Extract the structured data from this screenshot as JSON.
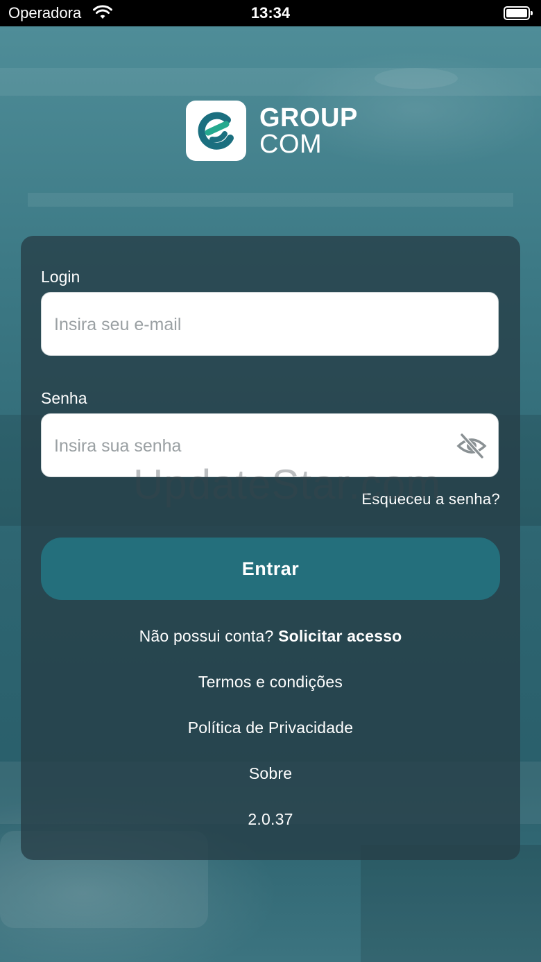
{
  "status_bar": {
    "carrier": "Operadora",
    "time": "13:34"
  },
  "brand": {
    "line1": "GROUP",
    "line2": "COM",
    "logo_color": "#1b6f7f",
    "logo_accent": "#25a98f"
  },
  "login_form": {
    "login_label": "Login",
    "email_placeholder": "Insira seu e-mail",
    "password_label": "Senha",
    "password_placeholder": "Insira sua senha",
    "forgot_password": "Esqueceu a senha?",
    "submit_label": "Entrar"
  },
  "links": {
    "no_account": "Não possui conta?",
    "request_access": "Solicitar acesso",
    "terms": "Termos e condições",
    "privacy": "Política de Privacidade",
    "about": "Sobre",
    "version": "2.0.37"
  },
  "watermark": "UpdateStar.com",
  "colors": {
    "button": "#246f7c",
    "card": "#263e46",
    "background": "#2f6a78"
  }
}
